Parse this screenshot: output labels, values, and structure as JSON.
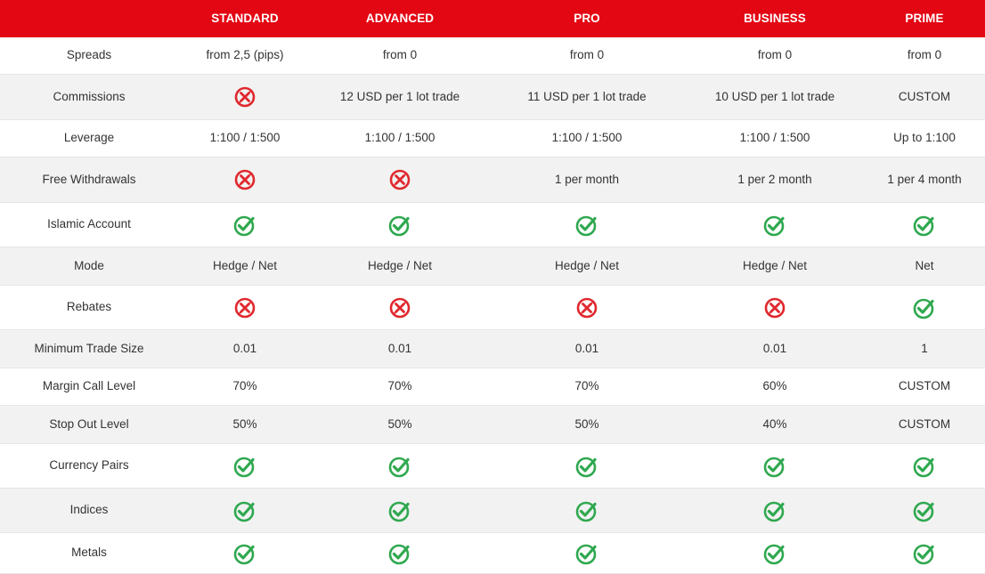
{
  "header": {
    "columns": [
      "",
      "STANDARD",
      "ADVANCED",
      "PRO",
      "BUSINESS",
      "PRIME"
    ]
  },
  "rows": [
    {
      "label": "Spreads",
      "height": 42,
      "alt": false,
      "cells": [
        {
          "t": "text",
          "v": "from 2,5 (pips)"
        },
        {
          "t": "text",
          "v": "from 0"
        },
        {
          "t": "text",
          "v": "from 0"
        },
        {
          "t": "text",
          "v": "from 0"
        },
        {
          "t": "text",
          "v": "from 0"
        }
      ]
    },
    {
      "label": "Commissions",
      "height": 51,
      "alt": true,
      "cells": [
        {
          "t": "no"
        },
        {
          "t": "text",
          "v": "12 USD per 1 lot trade"
        },
        {
          "t": "text",
          "v": "11 USD per 1 lot trade"
        },
        {
          "t": "text",
          "v": "10 USD per 1 lot trade"
        },
        {
          "t": "text",
          "v": "CUSTOM"
        }
      ]
    },
    {
      "label": "Leverage",
      "height": 42,
      "alt": false,
      "cells": [
        {
          "t": "text",
          "v": "1:100 / 1:500"
        },
        {
          "t": "text",
          "v": "1:100 / 1:500"
        },
        {
          "t": "text",
          "v": "1:100 / 1:500"
        },
        {
          "t": "text",
          "v": "1:100 / 1:500"
        },
        {
          "t": "text",
          "v": "Up to 1:100"
        }
      ]
    },
    {
      "label": "Free Withdrawals",
      "height": 51,
      "alt": true,
      "cells": [
        {
          "t": "no"
        },
        {
          "t": "no"
        },
        {
          "t": "text",
          "v": "1 per month"
        },
        {
          "t": "text",
          "v": "1 per 2 month"
        },
        {
          "t": "text",
          "v": "1 per 4 month"
        }
      ]
    },
    {
      "label": "Islamic Account",
      "height": 50,
      "alt": false,
      "cells": [
        {
          "t": "yes"
        },
        {
          "t": "yes"
        },
        {
          "t": "yes"
        },
        {
          "t": "yes"
        },
        {
          "t": "yes"
        }
      ]
    },
    {
      "label": "Mode",
      "height": 43,
      "alt": true,
      "cells": [
        {
          "t": "text",
          "v": "Hedge / Net"
        },
        {
          "t": "text",
          "v": "Hedge / Net"
        },
        {
          "t": "text",
          "v": "Hedge / Net"
        },
        {
          "t": "text",
          "v": "Hedge / Net"
        },
        {
          "t": "text",
          "v": "Net"
        }
      ]
    },
    {
      "label": "Rebates",
      "height": 50,
      "alt": false,
      "cells": [
        {
          "t": "no"
        },
        {
          "t": "no"
        },
        {
          "t": "no"
        },
        {
          "t": "no"
        },
        {
          "t": "yes"
        }
      ]
    },
    {
      "label": "Minimum Trade Size",
      "height": 43,
      "alt": true,
      "cells": [
        {
          "t": "text",
          "v": "0.01"
        },
        {
          "t": "text",
          "v": "0.01"
        },
        {
          "t": "text",
          "v": "0.01"
        },
        {
          "t": "text",
          "v": "0.01"
        },
        {
          "t": "text",
          "v": "1"
        }
      ]
    },
    {
      "label": "Margin Call Level",
      "height": 42,
      "alt": false,
      "cells": [
        {
          "t": "text",
          "v": "70%"
        },
        {
          "t": "text",
          "v": "70%"
        },
        {
          "t": "text",
          "v": "70%"
        },
        {
          "t": "text",
          "v": "60%"
        },
        {
          "t": "text",
          "v": "CUSTOM"
        }
      ]
    },
    {
      "label": "Stop Out Level",
      "height": 43,
      "alt": true,
      "cells": [
        {
          "t": "text",
          "v": "50%"
        },
        {
          "t": "text",
          "v": "50%"
        },
        {
          "t": "text",
          "v": "50%"
        },
        {
          "t": "text",
          "v": "40%"
        },
        {
          "t": "text",
          "v": "CUSTOM"
        }
      ]
    },
    {
      "label": "Currency Pairs",
      "height": 50,
      "alt": false,
      "cells": [
        {
          "t": "yes"
        },
        {
          "t": "yes"
        },
        {
          "t": "yes"
        },
        {
          "t": "yes"
        },
        {
          "t": "yes"
        }
      ]
    },
    {
      "label": "Indices",
      "height": 50,
      "alt": true,
      "cells": [
        {
          "t": "yes"
        },
        {
          "t": "yes"
        },
        {
          "t": "yes"
        },
        {
          "t": "yes"
        },
        {
          "t": "yes"
        }
      ]
    },
    {
      "label": "Metals",
      "height": 46,
      "alt": false,
      "cells": [
        {
          "t": "yes"
        },
        {
          "t": "yes"
        },
        {
          "t": "yes"
        },
        {
          "t": "yes"
        },
        {
          "t": "yes"
        }
      ]
    }
  ],
  "colors": {
    "header_bg": "#e30613",
    "check_green": "#2fa84f",
    "cross_red": "#e0282e",
    "alt_row": "#f2f2f2"
  },
  "icons": {
    "yes": "check-circle-icon",
    "no": "cross-circle-icon"
  }
}
